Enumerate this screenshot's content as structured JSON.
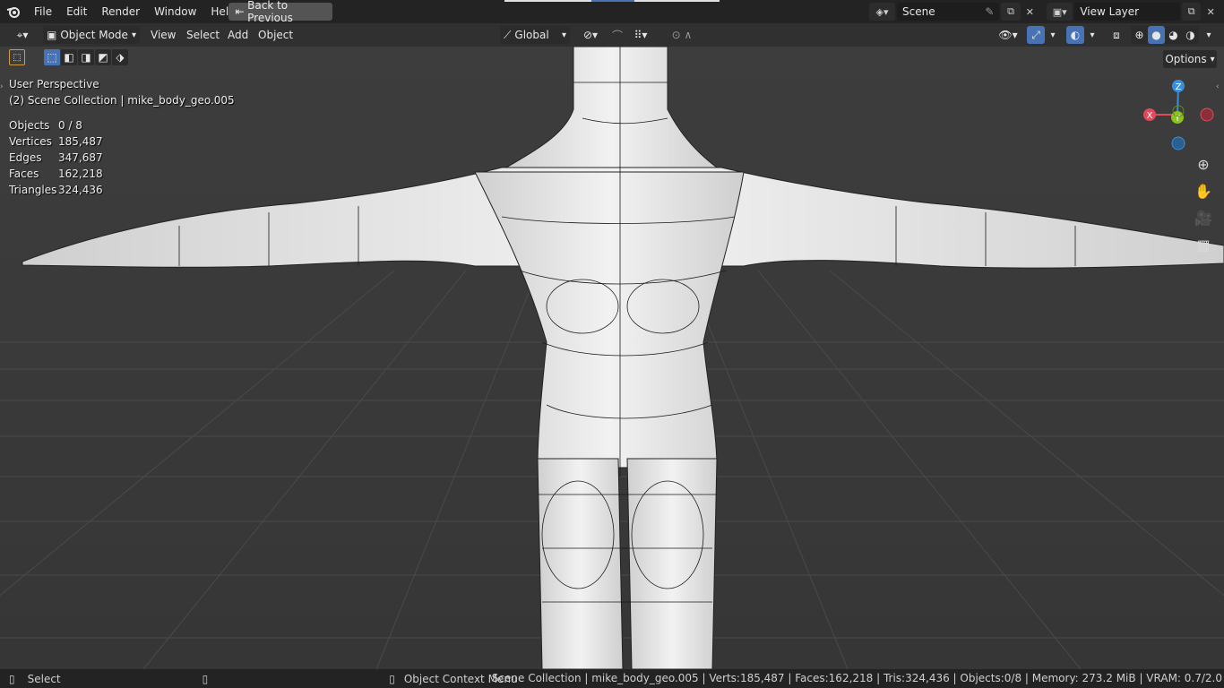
{
  "menubar": {
    "items": [
      "File",
      "Edit",
      "Render",
      "Window",
      "Help"
    ],
    "back_button": "Back to Previous",
    "scene_name": "Scene",
    "view_layer": "View Layer"
  },
  "header": {
    "mode": "Object Mode",
    "menus": [
      "View",
      "Select",
      "Add",
      "Object"
    ],
    "orientation": "Global",
    "options": "Options"
  },
  "viewport": {
    "perspective": "User Perspective",
    "collection": "(2) Scene Collection | mike_body_geo.005",
    "stats": [
      {
        "label": "Objects",
        "value": "0 / 8"
      },
      {
        "label": "Vertices",
        "value": "185,487"
      },
      {
        "label": "Edges",
        "value": "347,687"
      },
      {
        "label": "Faces",
        "value": "162,218"
      },
      {
        "label": "Triangles",
        "value": "324,436"
      }
    ],
    "gizmo": {
      "x": "X",
      "y": "Y",
      "z": "Z"
    }
  },
  "statusbar": {
    "select": "Select",
    "context_menu": "Object Context Menu",
    "info": "Scene Collection | mike_body_geo.005 | Verts:185,487 | Faces:162,218 | Tris:324,436 | Objects:0/8 | Memory: 273.2 MiB | VRAM: 0.7/2.0"
  },
  "colors": {
    "accent": "#4772b3",
    "axis_x": "#e04a5a",
    "axis_y": "#8bc21b",
    "axis_z": "#3d8ed9"
  }
}
